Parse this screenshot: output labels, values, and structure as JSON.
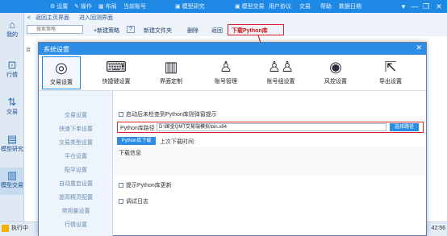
{
  "titlebar": {
    "items": [
      {
        "icon": "gear-icon",
        "glyph": "⚙",
        "label": "设置"
      },
      {
        "icon": "pencil-icon",
        "glyph": "✎",
        "label": "操作"
      },
      {
        "icon": "layout-icon",
        "glyph": "▦",
        "label": "布局"
      },
      {
        "icon": "account-icon",
        "glyph": "",
        "label": "当前账号"
      },
      {
        "icon": "strategy-research-icon",
        "glyph": "▣",
        "label": "模型研究"
      },
      {
        "icon": "model-trade-icon",
        "glyph": "▣",
        "label": "模型交易"
      },
      {
        "icon": "",
        "glyph": "",
        "label": "用户协议"
      },
      {
        "icon": "",
        "glyph": "",
        "label": "交易"
      },
      {
        "icon": "",
        "glyph": "",
        "label": "帮助"
      },
      {
        "icon": "",
        "glyph": "",
        "label": "数据日期"
      }
    ],
    "window_controls": [
      "▾",
      "—",
      "❐",
      "✕"
    ]
  },
  "sidebar": {
    "items": [
      {
        "icon": "home-icon",
        "glyph": "⌂",
        "label": "我的"
      },
      {
        "icon": "chart-icon",
        "glyph": "⊡",
        "label": "行情"
      },
      {
        "icon": "trade-icon",
        "glyph": "⇅",
        "label": "交易"
      },
      {
        "icon": "model-research-icon",
        "glyph": "▤",
        "label": "模型研究"
      },
      {
        "icon": "model-trade-icon",
        "glyph": "▥",
        "label": "模型交易"
      }
    ]
  },
  "breadcrumb": {
    "back": "<",
    "items": [
      "返回主页界面",
      "进入回测界面"
    ]
  },
  "toolbar": {
    "search_placeholder": "搜索策略",
    "back_label": "< 返回",
    "new_strategy": "+新建策略",
    "help": "?",
    "new_folder": "新建文件夹",
    "delete": "删除",
    "return": "返回",
    "download_python": "下载Python库"
  },
  "background_tab": "目",
  "dialog": {
    "title": "系统设置",
    "close": "✕",
    "tabs": [
      {
        "icon": "trade-settings-icon",
        "glyph": "◎",
        "label": "交易设置"
      },
      {
        "icon": "keyboard-icon",
        "glyph": "⌨",
        "label": "快捷键设置"
      },
      {
        "icon": "interface-icon",
        "glyph": "▥",
        "label": "界面定制"
      },
      {
        "icon": "account-manage-icon",
        "glyph": "♙",
        "label": "账号管理"
      },
      {
        "icon": "account-group-icon",
        "glyph": "♙♙",
        "label": "账号组设置"
      },
      {
        "icon": "risk-control-icon",
        "glyph": "◉",
        "label": "风控设置"
      },
      {
        "icon": "export-icon",
        "glyph": "⇱",
        "label": "导出设置"
      }
    ],
    "nav": [
      "交易设置",
      "快速下单设置",
      "交易类型设置",
      "平仓设置",
      "配平设置",
      "自动重启设置",
      "提高精灵配置",
      "常用量设置",
      "行情设置"
    ],
    "content": {
      "auto_check": "启动后未检查到Python库则弹窗提示",
      "path_label": "Python库路径",
      "path_value": "D:\\国金QMT交易端模拟\\bin.x64",
      "choose_path": "选择路径",
      "python_download": "Python库下载",
      "last_download": "上次下载时间:",
      "download_info": "下载信息",
      "notify_update": "提示Python库更新",
      "debug_log": "调试日志"
    }
  },
  "statusbar": {
    "left": "执行中",
    "time": "42:56"
  }
}
